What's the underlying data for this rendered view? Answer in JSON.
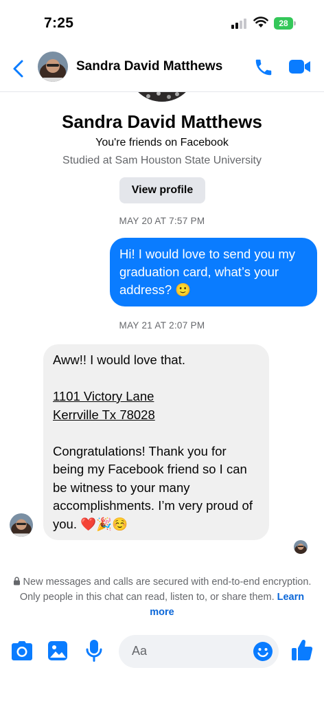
{
  "status_bar": {
    "time": "7:25",
    "battery": "28"
  },
  "header": {
    "name": "Sandra David Matthews"
  },
  "profile": {
    "name": "Sandra David Matthews",
    "friends_text": "You're friends on Facebook",
    "studied_text": "Studied at Sam Houston State University",
    "view_profile_label": "View profile"
  },
  "messages": [
    {
      "timestamp": "MAY 20 AT 7:57 PM"
    },
    {
      "text": "Hi! I would love to send you my graduation card, what’s your address? 🙂"
    },
    {
      "timestamp": "MAY 21 AT 2:07 PM"
    },
    {
      "line1": "Aww!! I would love that.",
      "address_line1": "1101 Victory Lane",
      "address_line2": "Kerrville Tx 78028",
      "line2": "Congratulations! Thank you for being my Facebook friend so I can be witness to your many accomplishments. I’m very proud of you. ❤️🎉☺️"
    }
  ],
  "encryption": {
    "text": "New messages and calls are secured with end-to-end encryption. Only people in this chat can read, listen to, or share them.",
    "learn_more": "Learn more"
  },
  "composer": {
    "placeholder": "Aa"
  },
  "colors": {
    "accent": "#0a7cff",
    "incoming_bubble": "#f0f0f0",
    "battery": "#34c759"
  },
  "icons": [
    "back-chevron-icon",
    "phone-icon",
    "video-camera-icon",
    "camera-icon",
    "gallery-icon",
    "microphone-icon",
    "emoji-icon",
    "thumbs-up-icon",
    "lock-icon"
  ]
}
